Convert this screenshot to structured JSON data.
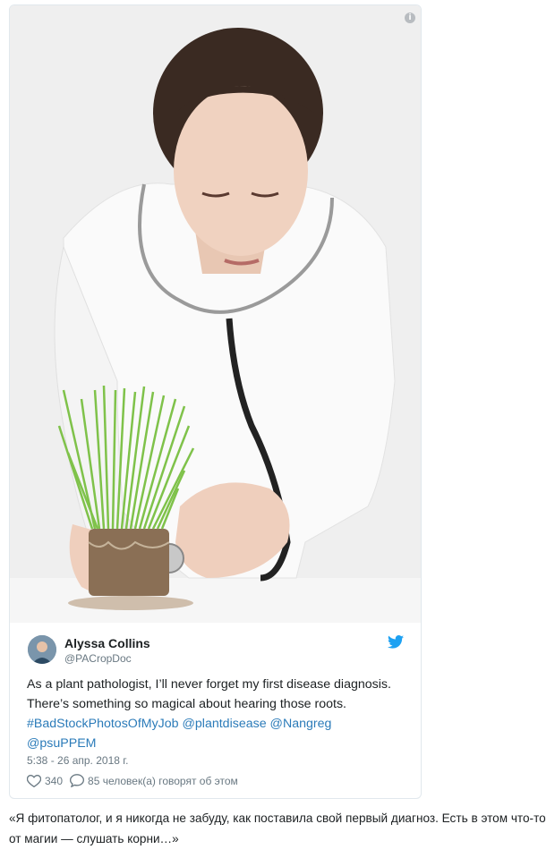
{
  "embed": {
    "info_icon": "info-icon",
    "photo_alt": "stock-photo-woman-stethoscope-grass"
  },
  "tweet": {
    "author_name": "Alyssa Collins",
    "author_handle": "@PACropDoc",
    "text_plain": "As a plant pathologist, I’ll never forget my first disease diagnosis.  There’s something so magical about hearing those roots. ",
    "hashtag": "#BadStockPhotosOfMyJob",
    "mention1": "@plantdisease",
    "mention2": "@Nangreg",
    "mention3": "@psuPPEM",
    "timestamp": "5:38 - 26 апр. 2018 г.",
    "likes": "340",
    "replies": "85 человек(а) говорят об этом"
  },
  "caption": "«Я фитопатолог, и я никогда не забуду, как поставила свой первый диагноз. Есть в этом что-то от магии — слушать корни…»",
  "colors": {
    "link": "#2b7bb9",
    "twitter_blue": "#1da1f2",
    "muted": "#697882"
  }
}
